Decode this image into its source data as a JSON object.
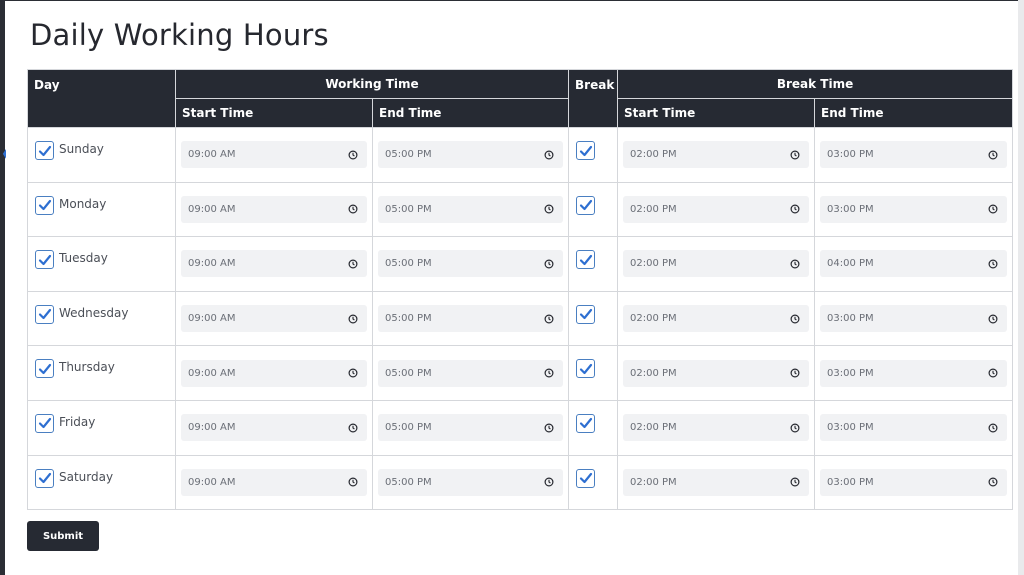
{
  "page": {
    "title": "Daily Working Hours"
  },
  "table": {
    "headers": {
      "day": "Day",
      "working_time": "Working Time",
      "break": "Break",
      "break_time": "Break Time",
      "start_time": "Start Time",
      "end_time": "End Time",
      "break_start_time": "Start Time",
      "break_end_time": "End Time"
    },
    "rows": [
      {
        "day": "Sunday",
        "enabled": true,
        "start": "09:00 AM",
        "end": "05:00 PM",
        "break": true,
        "break_start": "02:00 PM",
        "break_end": "03:00 PM"
      },
      {
        "day": "Monday",
        "enabled": true,
        "start": "09:00 AM",
        "end": "05:00 PM",
        "break": true,
        "break_start": "02:00 PM",
        "break_end": "03:00 PM"
      },
      {
        "day": "Tuesday",
        "enabled": true,
        "start": "09:00 AM",
        "end": "05:00 PM",
        "break": true,
        "break_start": "02:00 PM",
        "break_end": "04:00 PM"
      },
      {
        "day": "Wednesday",
        "enabled": true,
        "start": "09:00 AM",
        "end": "05:00 PM",
        "break": true,
        "break_start": "02:00 PM",
        "break_end": "03:00 PM"
      },
      {
        "day": "Thursday",
        "enabled": true,
        "start": "09:00 AM",
        "end": "05:00 PM",
        "break": true,
        "break_start": "02:00 PM",
        "break_end": "03:00 PM"
      },
      {
        "day": "Friday",
        "enabled": true,
        "start": "09:00 AM",
        "end": "05:00 PM",
        "break": true,
        "break_start": "02:00 PM",
        "break_end": "03:00 PM"
      },
      {
        "day": "Saturday",
        "enabled": true,
        "start": "09:00 AM",
        "end": "05:00 PM",
        "break": true,
        "break_start": "02:00 PM",
        "break_end": "03:00 PM"
      }
    ]
  },
  "actions": {
    "submit_label": "Submit"
  },
  "icons": {
    "checkbox": "check-icon",
    "time": "clock-icon",
    "side": "chevron-left-icon"
  },
  "colors": {
    "header_bg": "#262a33",
    "accent": "#2e6fd1",
    "field_bg": "#f1f2f4"
  }
}
